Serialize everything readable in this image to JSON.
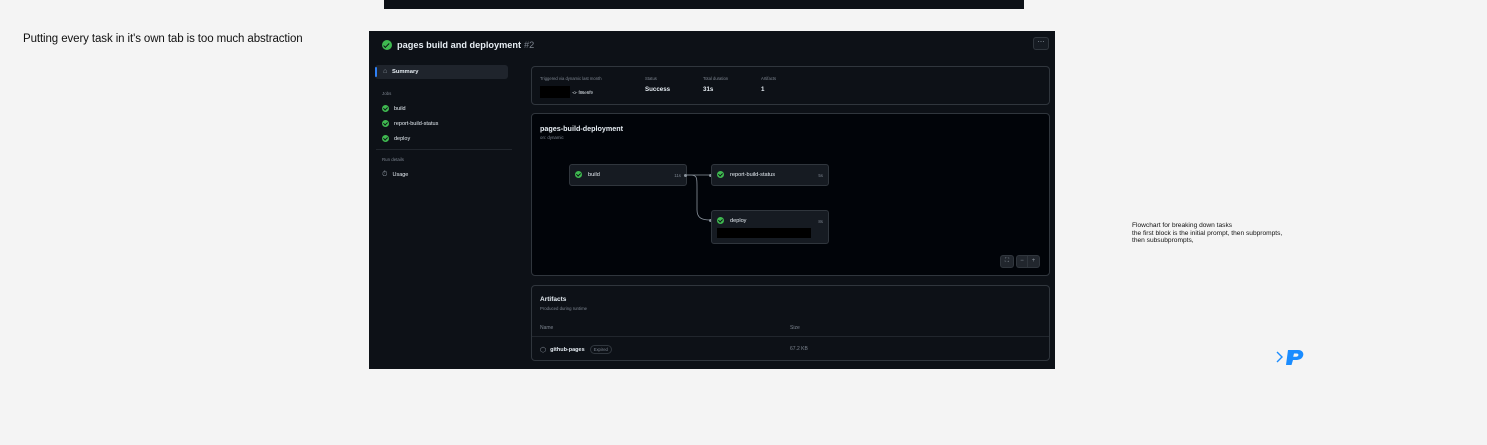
{
  "note_left": "Putting every task in it's own tab is too much abstraction",
  "note_right": {
    "lines": [
      "Flowchart for breaking down tasks",
      "the first block is the initial prompt, then subprompts,",
      "then subsubprompts,"
    ]
  },
  "colors": {
    "page_bg": "#f4f4f4",
    "panel_bg": "#0d1117",
    "success": "#3fb950",
    "accent": "#2f81f7",
    "logo": "#1a8cff"
  },
  "run": {
    "title": "pages build and deployment",
    "number": "#2",
    "menu_icon": "kebab-icon",
    "menu_glyph": "⋯"
  },
  "sidebar": {
    "summary_label": "Summary",
    "summary_icon": "home-icon",
    "jobs_heading": "Jobs",
    "jobs": [
      "build",
      "report-build-status",
      "deploy"
    ],
    "run_details_heading": "Run details",
    "usage_label": "Usage"
  },
  "summary": {
    "triggered_label": "Triggered via dynamic last month",
    "commit": "-o- f86e6f9",
    "status_label": "Status",
    "status_value": "Success",
    "duration_label": "Total duration",
    "duration_value": "31s",
    "artifacts_label": "Artifacts",
    "artifacts_value": "1"
  },
  "workflow": {
    "name": "pages-build-deployment",
    "trigger": "on: dynamic",
    "nodes": [
      {
        "label": "build",
        "duration": "11s"
      },
      {
        "label": "report-build-status",
        "duration": "5s"
      },
      {
        "label": "deploy",
        "duration": "8s"
      }
    ],
    "controls": {
      "fullscreen": "⛶",
      "zoom_out": "−",
      "zoom_in": "+"
    }
  },
  "artifacts": {
    "title": "Artifacts",
    "subtitle": "Produced during runtime",
    "col_name": "Name",
    "col_size": "Size",
    "items": [
      {
        "name": "github-pages",
        "badge": "Expired",
        "size": "67.2 KB"
      }
    ]
  }
}
